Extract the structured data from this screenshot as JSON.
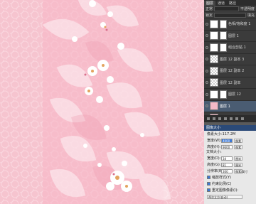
{
  "layers_panel": {
    "tabs": [
      "图层",
      "通道",
      "路径"
    ],
    "mode_label": "正常",
    "opacity_label": "不透明度",
    "fill_label": "填充",
    "lock_label": "锁定",
    "layers": [
      {
        "name": "色相/饱和度 1",
        "thumb": "white",
        "mask": true,
        "selected": false
      },
      {
        "name": "图层 1",
        "thumb": "white",
        "mask": true,
        "selected": false
      },
      {
        "name": "组合剪贴 1",
        "thumb": "white",
        "mask": true,
        "selected": false
      },
      {
        "name": "图层 12 副本 3",
        "thumb": "checker",
        "mask": false,
        "selected": false
      },
      {
        "name": "图层 12 副本 2",
        "thumb": "checker",
        "mask": false,
        "selected": false
      },
      {
        "name": "图层 12 副本",
        "thumb": "checker",
        "mask": false,
        "selected": false
      },
      {
        "name": "图层 12",
        "thumb": "white",
        "mask": true,
        "selected": false
      },
      {
        "name": "图层 1",
        "thumb": "pink",
        "mask": false,
        "selected": true
      },
      {
        "name": "背景",
        "thumb": "pink",
        "mask": false,
        "selected": false
      }
    ]
  },
  "dialog": {
    "title": "图像大小",
    "pixel_dims": "像素大小:117.2M",
    "width_label": "宽度(W):",
    "width_value": "4000",
    "width_unit": "像素",
    "height_label": "高度(H):",
    "height_value": "9600",
    "height_unit": "像素",
    "doc_size_label": "文档大小:",
    "doc_width_label": "宽度(D):",
    "doc_width_value": "34",
    "doc_width_unit": "厘米",
    "doc_height_label": "高度(G):",
    "doc_height_value": "81",
    "doc_height_unit": "厘米",
    "resolution_label": "分辨率(R):",
    "resolution_value": "300",
    "resolution_unit": "像素/英寸",
    "scale_styles_label": "缩放样式(Y)",
    "constrain_label": "约束比例(C)",
    "resample_label": "重定图像像素(I):",
    "resample_method": "两次立方(自动)"
  }
}
